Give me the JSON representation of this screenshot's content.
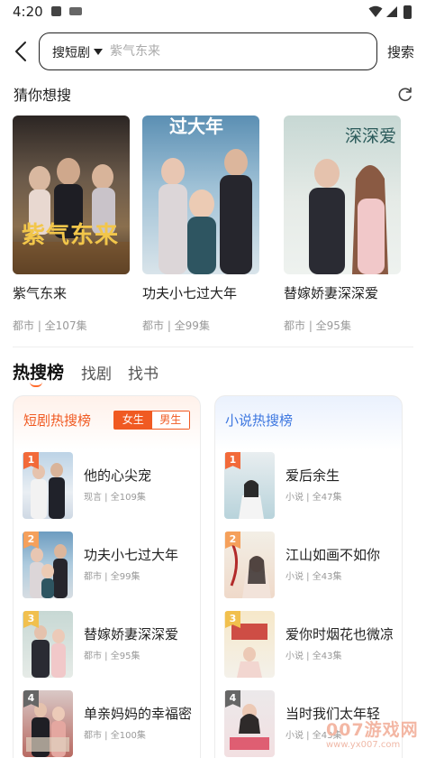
{
  "status_bar": {
    "time": "4:20"
  },
  "search": {
    "scope_label": "搜短剧",
    "placeholder": "紫气东来",
    "search_button": "搜索"
  },
  "guess": {
    "title": "猜你想搜",
    "items": [
      {
        "title": "紫气东来",
        "genre": "都市",
        "episodes": "全107集",
        "meta": "都市 | 全107集",
        "poster_text": "紫气东来"
      },
      {
        "title": "功夫小七过大年",
        "genre": "都市",
        "episodes": "全99集",
        "meta": "都市 | 全99集",
        "poster_text": "过大年"
      },
      {
        "title": "替嫁娇妻深深爱",
        "genre": "都市",
        "episodes": "全95集",
        "meta": "都市 | 全95集",
        "poster_text": "深深爱"
      }
    ]
  },
  "tabs": [
    {
      "label": "热搜榜",
      "active": true
    },
    {
      "label": "找剧",
      "active": false
    },
    {
      "label": "找书",
      "active": false
    }
  ],
  "short_drama_panel": {
    "title": "短剧热搜榜",
    "toggle": {
      "female": "女生",
      "male": "男生",
      "selected": "女生"
    },
    "items": [
      {
        "rank": "1",
        "title": "他的心尖宠",
        "meta": "现言 | 全109集"
      },
      {
        "rank": "2",
        "title": "功夫小七过大年",
        "meta": "都市 | 全99集"
      },
      {
        "rank": "3",
        "title": "替嫁娇妻深深爱",
        "meta": "都市 | 全95集"
      },
      {
        "rank": "4",
        "title": "单亲妈妈的幸福密",
        "meta": "都市 | 全100集"
      }
    ]
  },
  "novel_panel": {
    "title": "小说热搜榜",
    "items": [
      {
        "rank": "1",
        "title": "爱后余生",
        "meta": "小说 | 全47集"
      },
      {
        "rank": "2",
        "title": "江山如画不如你",
        "meta": "小说 | 全43集"
      },
      {
        "rank": "3",
        "title": "爱你时烟花也微凉",
        "meta": "小说 | 全43集"
      },
      {
        "rank": "4",
        "title": "当时我们太年轻",
        "meta": "小说 | 全43集"
      }
    ]
  },
  "watermark": {
    "brand": "007游戏网",
    "url": "www.yx007.com"
  },
  "colors": {
    "accent_orange": "#f05a22",
    "accent_blue": "#3d77e0",
    "rank_1": "#f26a3a",
    "rank_2": "#f5a05b",
    "rank_3": "#f1c04e",
    "rank_4": "#666666"
  }
}
